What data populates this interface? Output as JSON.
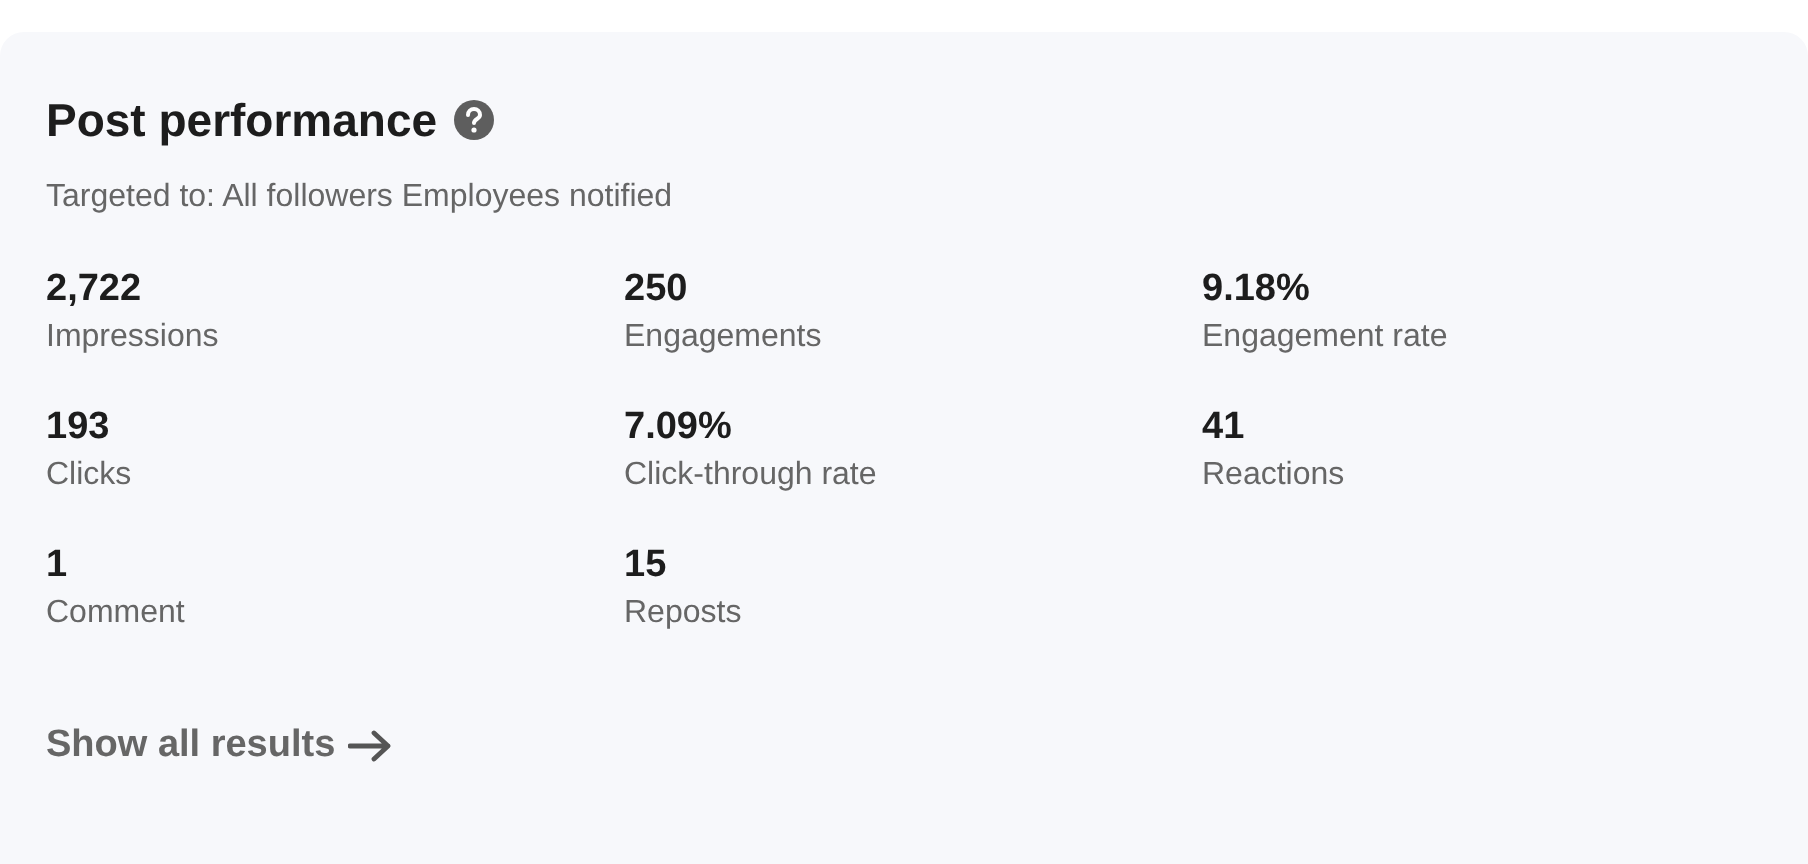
{
  "title": "Post performance",
  "subtitle": "Targeted to: All followers Employees notified",
  "metrics": [
    {
      "value": "2,722",
      "label": "Impressions"
    },
    {
      "value": "250",
      "label": "Engagements"
    },
    {
      "value": "9.18%",
      "label": "Engagement rate"
    },
    {
      "value": "193",
      "label": "Clicks"
    },
    {
      "value": "7.09%",
      "label": "Click-through rate"
    },
    {
      "value": "41",
      "label": "Reactions"
    },
    {
      "value": "1",
      "label": "Comment"
    },
    {
      "value": "15",
      "label": "Reposts"
    }
  ],
  "link": "Show all results"
}
